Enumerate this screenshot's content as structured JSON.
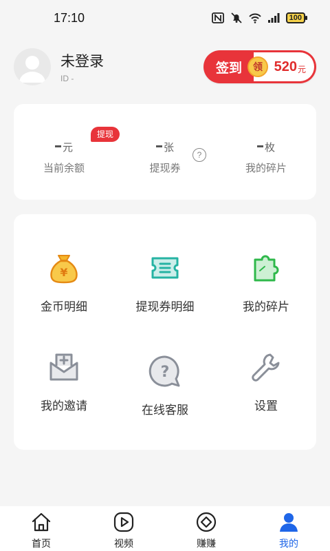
{
  "status_bar": {
    "time": "17:10",
    "battery": "100"
  },
  "profile": {
    "username": "未登录",
    "user_id": "ID -"
  },
  "checkin": {
    "label": "签到",
    "coin_text": "领",
    "amount": "520",
    "unit": "元"
  },
  "stats": {
    "badge": "提现",
    "items": [
      {
        "value_suffix": "元",
        "label": "当前余额"
      },
      {
        "value_suffix": "张",
        "label": "提现券"
      },
      {
        "value_suffix": "枚",
        "label": "我的碎片"
      }
    ],
    "help_icon": "?"
  },
  "grid": {
    "items": [
      {
        "label": "金币明细",
        "icon": "money-bag-icon"
      },
      {
        "label": "提现券明细",
        "icon": "ticket-icon"
      },
      {
        "label": "我的碎片",
        "icon": "puzzle-icon"
      },
      {
        "label": "我的邀请",
        "icon": "invite-mail-icon"
      },
      {
        "label": "在线客服",
        "icon": "help-chat-icon"
      },
      {
        "label": "设置",
        "icon": "wrench-icon"
      }
    ]
  },
  "tabbar": {
    "items": [
      {
        "label": "首页",
        "icon": "home-icon"
      },
      {
        "label": "视频",
        "icon": "video-icon"
      },
      {
        "label": "赚赚",
        "icon": "earn-icon"
      },
      {
        "label": "我的",
        "icon": "user-icon"
      }
    ],
    "active_index": 3
  },
  "colors": {
    "accent_red": "#e8343a",
    "active_blue": "#1f66e8",
    "orange": "#f39a1e",
    "teal": "#26b3a3",
    "green": "#2fb84b",
    "gray_icon": "#8a8f99"
  }
}
